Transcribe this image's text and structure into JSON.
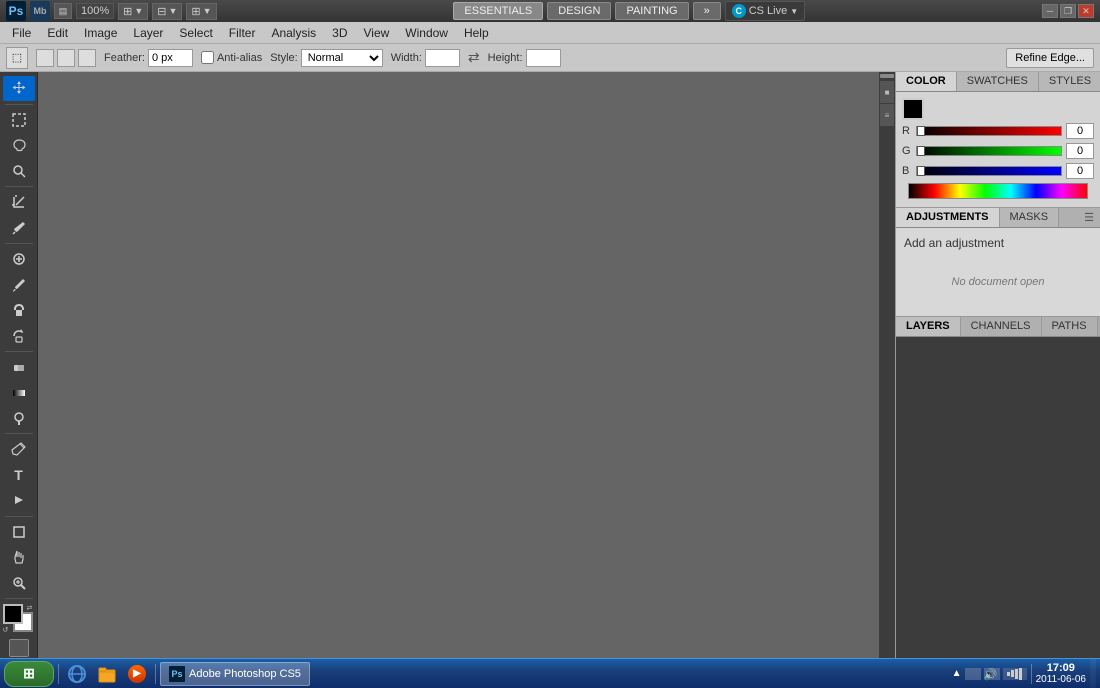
{
  "titlebar": {
    "zoom": "100%",
    "workspace_buttons": [
      "ESSENTIALS",
      "DESIGN",
      "PAINTING"
    ],
    "active_workspace": "ESSENTIALS",
    "more_btn": "»",
    "cs_live": "CS Live",
    "win_minimize": "─",
    "win_restore": "❐",
    "win_close": "✕"
  },
  "menubar": {
    "items": [
      "File",
      "Edit",
      "Image",
      "Layer",
      "Select",
      "Filter",
      "Analysis",
      "3D",
      "View",
      "Window",
      "Help"
    ]
  },
  "optionsbar": {
    "feather_label": "Feather:",
    "feather_value": "0 px",
    "antialias_label": "Anti-alias",
    "style_label": "Style:",
    "style_value": "Normal",
    "width_label": "Width:",
    "height_label": "Height:",
    "refine_edge_btn": "Refine Edge..."
  },
  "color_panel": {
    "tabs": [
      "COLOR",
      "SWATCHES",
      "STYLES"
    ],
    "active_tab": "COLOR",
    "r_label": "R",
    "r_value": "0",
    "g_label": "G",
    "g_value": "0",
    "b_label": "B",
    "b_value": "0"
  },
  "adjustments_panel": {
    "tabs": [
      "ADJUSTMENTS",
      "MASKS"
    ],
    "active_tab": "ADJUSTMENTS",
    "title": "Add an adjustment",
    "no_doc_msg": "No document open"
  },
  "layers_panel": {
    "tabs": [
      "LAYERS",
      "CHANNELS",
      "PATHS"
    ],
    "active_tab": "LAYERS"
  },
  "taskbar": {
    "start_label": "Start",
    "apps": [
      "IE",
      "Explorer",
      "WinAmp",
      "Photoshop"
    ],
    "time": "17:09",
    "date": "2011-06-06"
  },
  "tools": {
    "list": [
      {
        "name": "move",
        "icon": "✛"
      },
      {
        "name": "marquee",
        "icon": "⬚"
      },
      {
        "name": "lasso",
        "icon": "⌖"
      },
      {
        "name": "quick-select",
        "icon": "⚙"
      },
      {
        "name": "crop",
        "icon": "⊹"
      },
      {
        "name": "eyedropper",
        "icon": "/"
      },
      {
        "name": "spot-heal",
        "icon": "⊛"
      },
      {
        "name": "brush",
        "icon": "✏"
      },
      {
        "name": "clone-stamp",
        "icon": "⊕"
      },
      {
        "name": "history-brush",
        "icon": "↩"
      },
      {
        "name": "eraser",
        "icon": "◻"
      },
      {
        "name": "gradient",
        "icon": "▦"
      },
      {
        "name": "dodge",
        "icon": "◑"
      },
      {
        "name": "pen",
        "icon": "✒"
      },
      {
        "name": "type",
        "icon": "T"
      },
      {
        "name": "path-select",
        "icon": "▶"
      },
      {
        "name": "shape",
        "icon": "◻"
      },
      {
        "name": "hand",
        "icon": "✋"
      },
      {
        "name": "zoom",
        "icon": "🔍"
      }
    ]
  }
}
